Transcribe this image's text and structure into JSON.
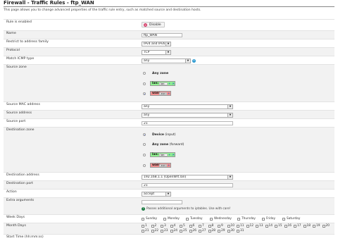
{
  "page": {
    "title": "Firewall - Traffic Rules - ftp_WAN",
    "description": "This page allows you to change advanced properties of the traffic rule entry, such as matched source and destination hosts."
  },
  "labels": {
    "rule_enabled": "Rule is enabled",
    "name": "Name",
    "restrict_family": "Restrict to address family",
    "protocol": "Protocol",
    "match_icmp": "Match ICMP type",
    "source_zone": "Source zone",
    "source_mac": "Source MAC address",
    "source_address": "Source address",
    "source_port": "Source port",
    "destination_zone": "Destination zone",
    "destination_address": "Destination address",
    "destination_port": "Destination port",
    "action": "Action",
    "extra_arguments": "Extra arguments",
    "week_days": "Week Days",
    "month_days": "Month Days",
    "start_time": "Start Time (hh:mm:ss)"
  },
  "values": {
    "disable_button": "Disable",
    "name": "ftp_WAN",
    "restrict_family": "IPv4 and IPv6",
    "protocol": "TCP",
    "match_icmp": "any",
    "source_mac": "any",
    "source_address": "any",
    "source_port": "21",
    "destination_address": "192.168.1.1 (OpenWrt.lan)",
    "destination_port": "21",
    "action": "accept",
    "extra_arguments": "",
    "extra_hint": "Passes additional arguments to iptables. Use with care!"
  },
  "source_zones": [
    {
      "name": "Any zone",
      "selected": false
    },
    {
      "name": "lan:",
      "inner": "lan:",
      "selected": false
    },
    {
      "name": "wan:",
      "inner": "wan:",
      "selected": true
    }
  ],
  "destination_zones": [
    {
      "name": "Device",
      "sub": " (input)",
      "selected": true
    },
    {
      "name": "Any zone",
      "sub": " (forward)",
      "selected": false
    },
    {
      "name": "lan:",
      "inner": "lan:",
      "selected": false
    },
    {
      "name": "wan:",
      "inner": "wan:",
      "selected": false
    }
  ],
  "week_days": [
    "Sunday",
    "Monday",
    "Tuesday",
    "Wednesday",
    "Thursday",
    "Friday",
    "Saturday"
  ],
  "month_days": [
    "1",
    "2",
    "3",
    "4",
    "5",
    "6",
    "7",
    "8",
    "9",
    "10",
    "11",
    "12",
    "13",
    "14",
    "15",
    "16",
    "17",
    "18",
    "19",
    "20",
    "21",
    "22",
    "23",
    "24",
    "25",
    "26",
    "27",
    "28",
    "29",
    "30",
    "31"
  ],
  "colors": {
    "lan": "#90f090",
    "wan": "#f09090",
    "radio_selected": "#3b56c9",
    "disable": "#d43a66"
  },
  "icons": {
    "help": "help-icon",
    "ethernet": "ethernet-icon",
    "wifi": "wifi-icon"
  }
}
